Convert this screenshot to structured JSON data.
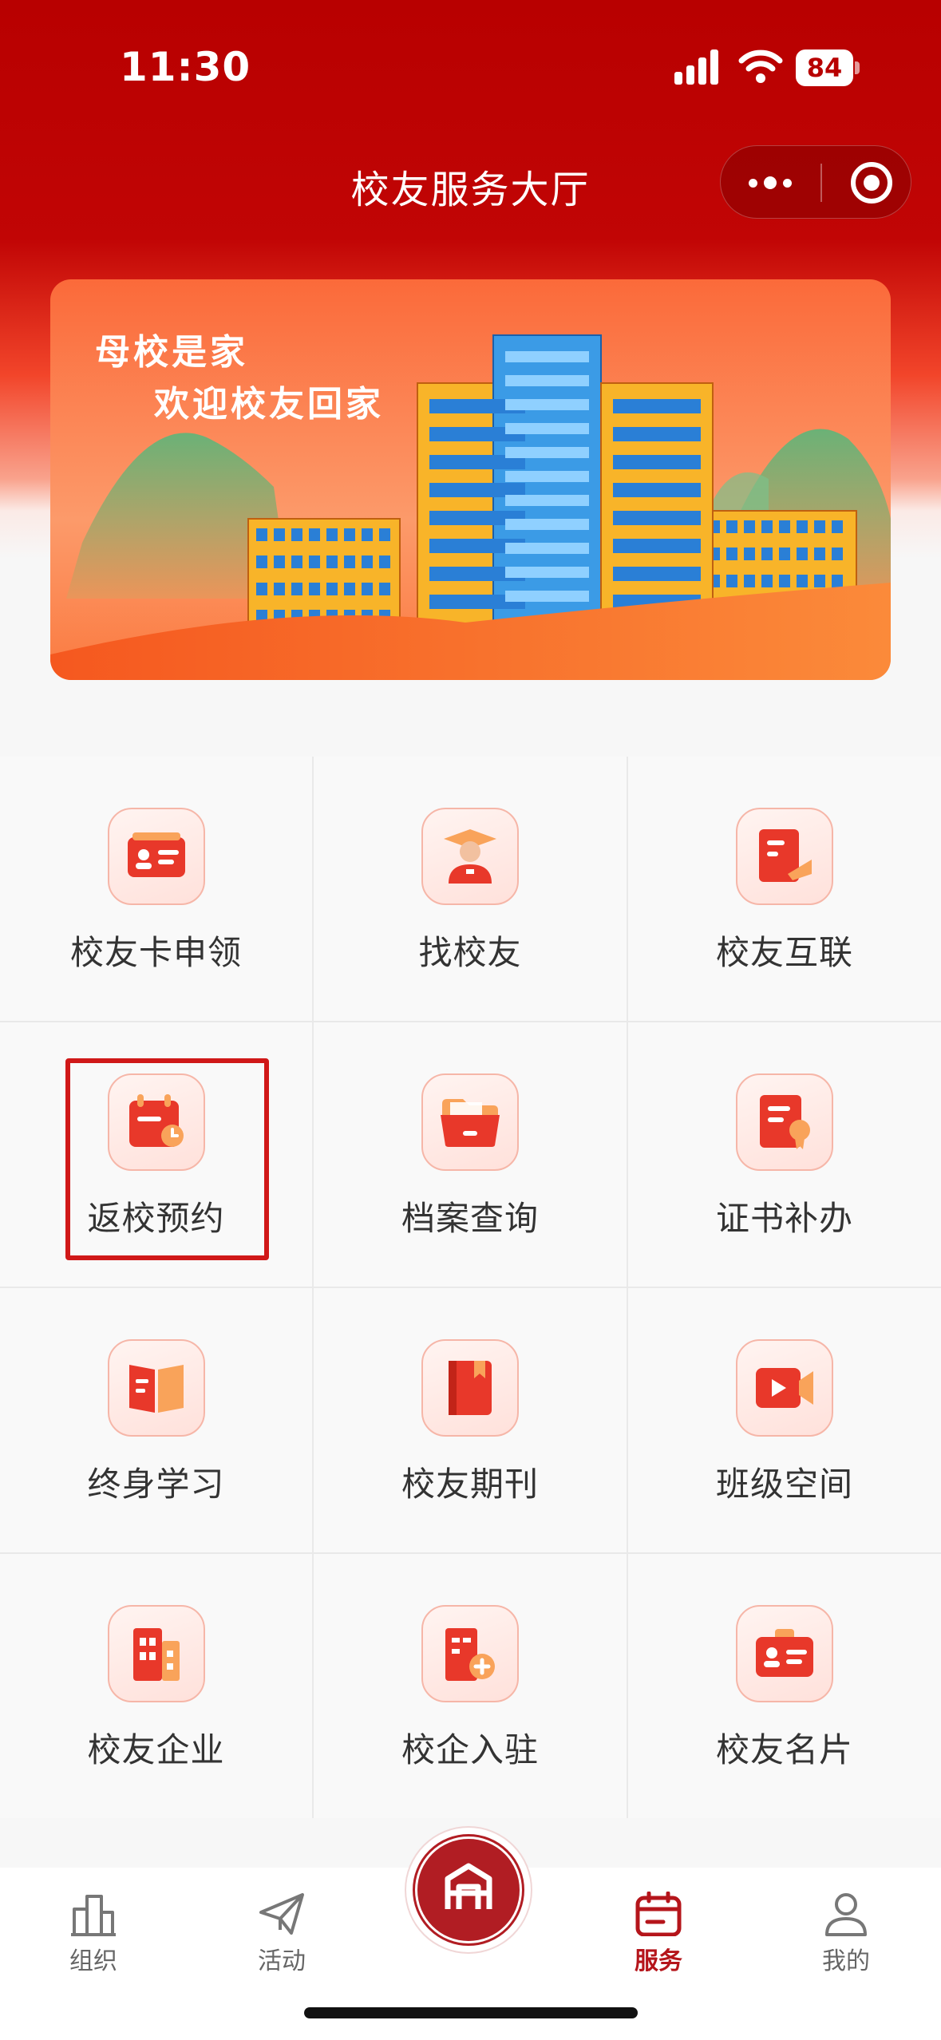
{
  "status_bar": {
    "time": "11:30",
    "battery": "84"
  },
  "nav": {
    "title": "校友服务大厅",
    "more_icon": "more-dots-icon",
    "close_icon": "close-target-icon"
  },
  "banner": {
    "line1": "母校是家",
    "line2": "欢迎校友回家"
  },
  "services": [
    {
      "label": "校友卡申领",
      "icon": "id-card-icon"
    },
    {
      "label": "找校友",
      "icon": "graduate-person-icon"
    },
    {
      "label": "校友互联",
      "icon": "document-pen-icon"
    },
    {
      "label": "返校预约",
      "icon": "calendar-clock-icon"
    },
    {
      "label": "档案查询",
      "icon": "folder-icon"
    },
    {
      "label": "证书补办",
      "icon": "certificate-icon"
    },
    {
      "label": "终身学习",
      "icon": "open-book-icon"
    },
    {
      "label": "校友期刊",
      "icon": "magazine-icon"
    },
    {
      "label": "班级空间",
      "icon": "video-camera-icon"
    },
    {
      "label": "校友企业",
      "icon": "building-icon"
    },
    {
      "label": "校企入驻",
      "icon": "building-add-icon"
    },
    {
      "label": "校友名片",
      "icon": "name-card-icon"
    }
  ],
  "highlighted_service": "返校预约",
  "tabbar": {
    "items": [
      {
        "label": "组织",
        "icon": "organization-icon"
      },
      {
        "label": "活动",
        "icon": "paper-plane-icon"
      },
      {
        "label": "服务",
        "icon": "calendar-icon",
        "active": true
      },
      {
        "label": "我的",
        "icon": "user-icon"
      }
    ],
    "center_logo": {
      "icon": "university-emblem-icon"
    }
  },
  "colors": {
    "primary": "#b80000",
    "active_tab": "#b5151b",
    "highlight_border": "#d01818"
  }
}
